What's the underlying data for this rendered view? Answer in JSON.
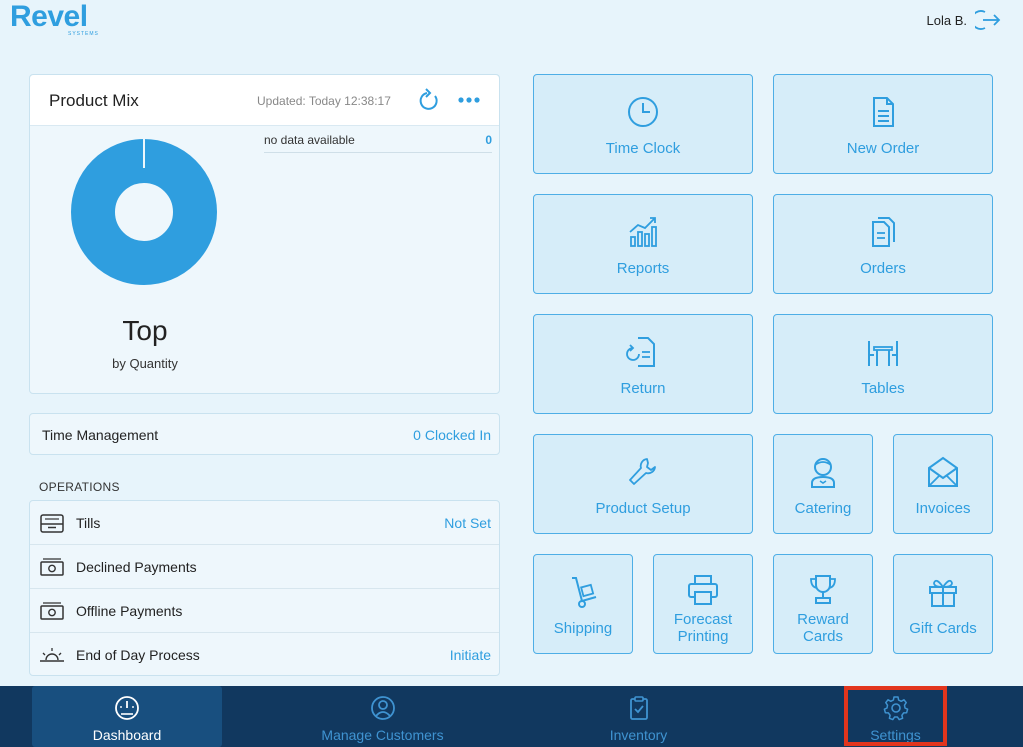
{
  "header": {
    "logo_text": "Revel",
    "logo_sub": "SYSTEMS",
    "user_name": "Lola B."
  },
  "product_mix": {
    "title": "Product Mix",
    "updated": "Updated: Today 12:38:17",
    "no_data_label": "no data available",
    "no_data_count": "0",
    "top_label": "Top",
    "by_label": "by Quantity"
  },
  "time_management": {
    "title": "Time Management",
    "value": "0 Clocked In"
  },
  "operations": {
    "section_label": "OPERATIONS",
    "rows": [
      {
        "label": "Tills",
        "value": "Not Set"
      },
      {
        "label": "Declined Payments",
        "value": ""
      },
      {
        "label": "Offline Payments",
        "value": ""
      },
      {
        "label": "End of Day Process",
        "value": "Initiate"
      }
    ]
  },
  "tiles": {
    "time_clock": "Time Clock",
    "new_order": "New Order",
    "reports": "Reports",
    "orders": "Orders",
    "return": "Return",
    "tables": "Tables",
    "product_setup": "Product Setup",
    "catering": "Catering",
    "invoices": "Invoices",
    "shipping": "Shipping",
    "forecast_printing": "Forecast Printing",
    "reward_cards": "Reward Cards",
    "gift_cards": "Gift Cards"
  },
  "bottom_nav": {
    "dashboard": "Dashboard",
    "manage_customers": "Manage Customers",
    "inventory": "Inventory",
    "settings": "Settings"
  },
  "colors": {
    "accent": "#2f9edf",
    "tile_bg": "#d6edf9",
    "nav_bg": "#11385f",
    "highlight": "#e2351d"
  }
}
